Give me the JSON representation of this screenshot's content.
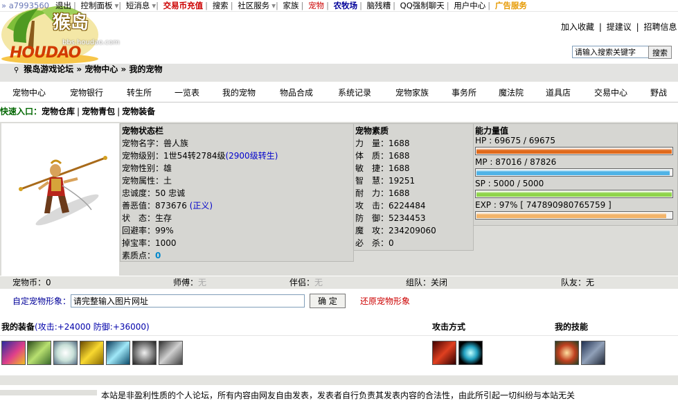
{
  "topbar": {
    "user": "» a7993560",
    "items": [
      "退出",
      "控制面板",
      "短消息",
      "交易币充值",
      "搜索",
      "社区服务",
      "家族",
      "宠物",
      "农牧场",
      "脑残糟",
      "QQ强制聊天",
      "用户中心",
      "广告服务"
    ]
  },
  "logo": {
    "cn": "猴岛",
    "en": "HOUDAO",
    "url": "bbs.houdao.com"
  },
  "right_links": {
    "fav": "加入收藏",
    "suggest": "提建议",
    "recruit": "招聘信息"
  },
  "search": {
    "placeholder": "请输入搜索关键字",
    "button": "搜索"
  },
  "breadcrumb": {
    "forum": "猴岛游戏论坛",
    "center": "宠物中心",
    "mine": "我的宠物",
    "sep": "»"
  },
  "menu": [
    "宠物中心",
    "宠物银行",
    "转生所",
    "一览表",
    "我的宠物",
    "物品合成",
    "系统记录",
    "宠物家族",
    "事务所",
    "魔法院",
    "道具店",
    "交易中心",
    "野战"
  ],
  "quick": {
    "label": "快速入口：",
    "links": [
      "宠物仓库",
      "宠物青包",
      "宠物装备"
    ]
  },
  "status": {
    "title": "宠物状态栏",
    "name_label": "宠物名字：",
    "name": "兽人族",
    "level_label": "宠物级别：",
    "level": "1世54转2784级",
    "level_link": "(2900级转生)",
    "gender_label": "宠物性别：",
    "gender": "雄",
    "element_label": "宠物属性：",
    "element": "土",
    "loyalty_label": "忠诚度：",
    "loyalty": "50 忠诚",
    "morality_label": "善恶值：",
    "morality": "873676",
    "morality_tag": "(正义)",
    "state_label": "状　态：",
    "state": "生存",
    "return_label": "回避率：",
    "return_rate": "99%",
    "drop_label": "掉宝率：",
    "drop_rate": "1000",
    "points_label": "素质点：",
    "points": "0"
  },
  "attributes": {
    "title": "宠物素质",
    "rows": [
      {
        "label": "力　量：",
        "value": "1688"
      },
      {
        "label": "体　质：",
        "value": "1688"
      },
      {
        "label": "敏　捷：",
        "value": "1688"
      },
      {
        "label": "智　慧：",
        "value": "19251"
      },
      {
        "label": "耐　力：",
        "value": "1688"
      },
      {
        "label": "攻　击：",
        "value": "6224484"
      },
      {
        "label": "防　御：",
        "value": "5234453"
      },
      {
        "label": "魔　攻：",
        "value": "234209060"
      },
      {
        "label": "必　杀：",
        "value": "0"
      }
    ]
  },
  "ability": {
    "title": "能力量值",
    "hp": {
      "text": "HP :  69675 / 69675",
      "fraction": 1.0,
      "color": "#e06a1c"
    },
    "mp": {
      "text": "MP :  87016 / 87826",
      "fraction": 0.99,
      "color": "#4fb3e6"
    },
    "sp": {
      "text": "SP :  5000 / 5000",
      "fraction": 1.0,
      "color": "#8fd44b"
    },
    "exp": {
      "text": "EXP :  97% [ 747890980765759 ]",
      "fraction": 0.97,
      "color": "#f2b46a"
    }
  },
  "info": {
    "coin_label": "宠物币：",
    "coin": "0",
    "master_label": "师傅：",
    "master": "无",
    "partner_label": "伴侣：",
    "partner": "无",
    "team_label": "组队：",
    "team": "关闭",
    "mate_label": "队友：",
    "mate": "无"
  },
  "custom": {
    "label": "自定宠物形象：",
    "value": "请完整输入图片网址",
    "confirm": "确 定",
    "restore": "还原宠物形象"
  },
  "equipment": {
    "title": "我的装备",
    "stats": "(攻击:+24000 防御:+36000)"
  },
  "attack": {
    "title": "攻击方式"
  },
  "skills": {
    "title": "我的技能"
  },
  "footer": {
    "text": "本站是非盈利性质的个人论坛，所有内容由网友自由发表，发表者自行负责其发表内容的合法性，由此所引起一切纠纷与本站无关"
  }
}
